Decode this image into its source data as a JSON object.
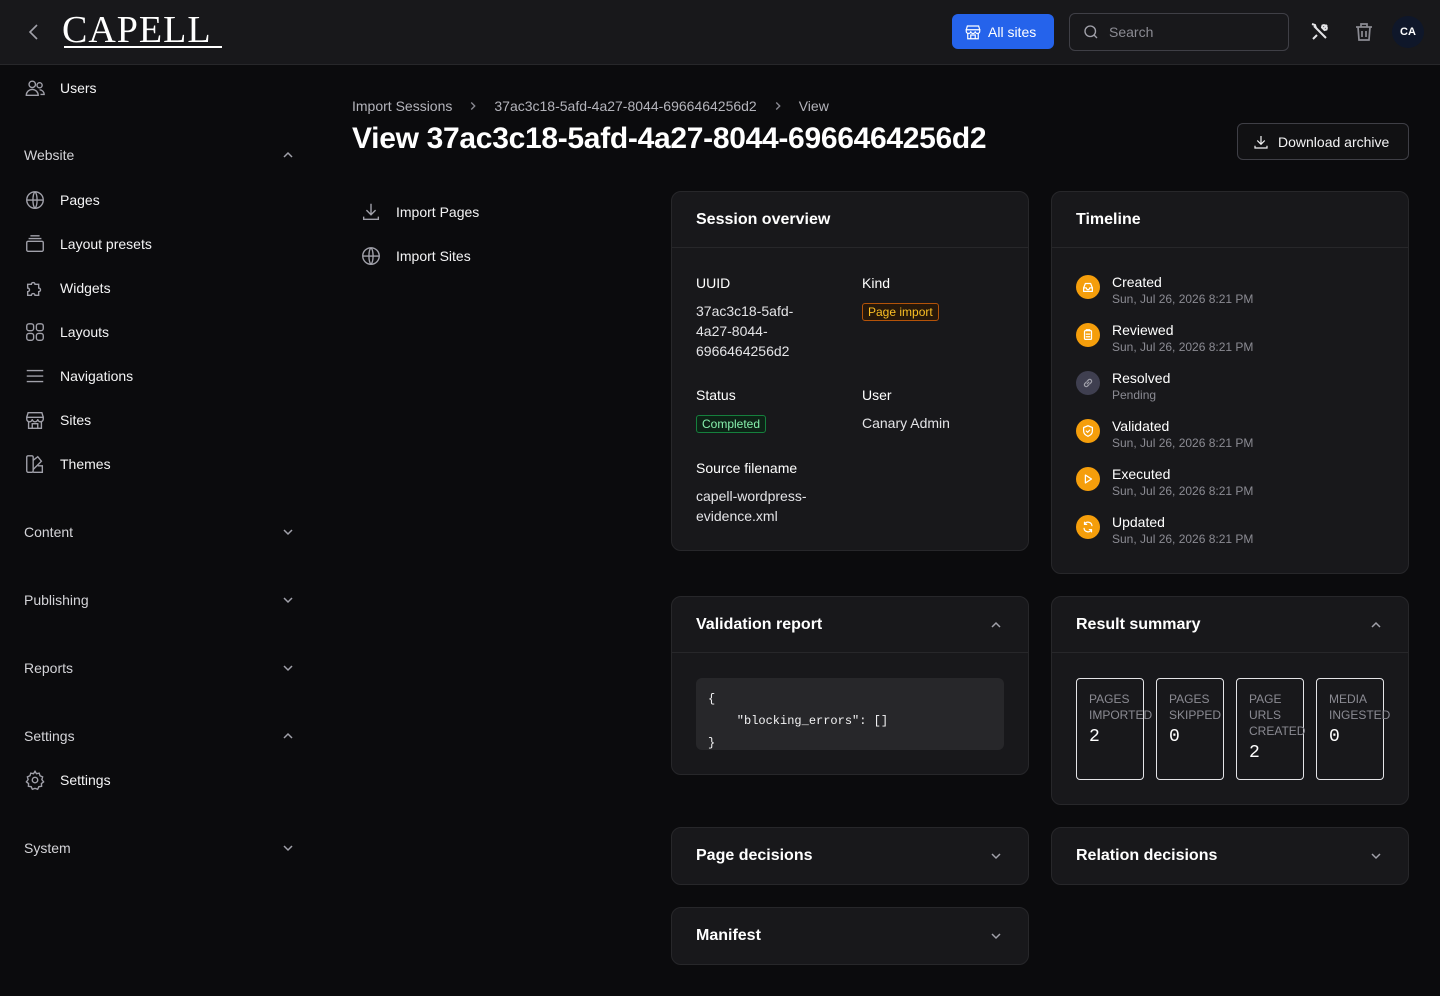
{
  "topbar": {
    "logo": "CAPELL",
    "all_sites_label": "All sites",
    "search_placeholder": "Search",
    "avatar_initials": "CA"
  },
  "sidebar": {
    "users_label": "Users",
    "website": {
      "label": "Website",
      "items": [
        "Pages",
        "Layout presets",
        "Widgets",
        "Layouts",
        "Navigations",
        "Sites",
        "Themes"
      ]
    },
    "content_label": "Content",
    "publishing_label": "Publishing",
    "reports_label": "Reports",
    "settings": {
      "label": "Settings",
      "items": [
        "Settings"
      ]
    },
    "system_label": "System"
  },
  "breadcrumb": [
    "Import Sessions",
    "37ac3c18-5afd-4a27-8044-6966464256d2",
    "View"
  ],
  "page_title": "View 37ac3c18-5afd-4a27-8044-6966464256d2",
  "download_label": "Download archive",
  "subnav": [
    "Import Pages",
    "Import Sites"
  ],
  "session_overview": {
    "title": "Session overview",
    "uuid_label": "UUID",
    "uuid_lines": [
      "37ac3c18-5afd-",
      "4a27-8044-",
      "6966464256d2"
    ],
    "kind_label": "Kind",
    "kind_value": "Page import",
    "status_label": "Status",
    "status_value": "Completed",
    "user_label": "User",
    "user_value": "Canary Admin",
    "source_label": "Source filename",
    "source_lines": [
      "capell-wordpress-",
      "evidence.xml"
    ]
  },
  "timeline": {
    "title": "Timeline",
    "items": [
      {
        "name": "Created",
        "time": "Sun, Jul 26, 2026 8:21 PM",
        "icon": "inbox-icon",
        "color": "#f59e0b"
      },
      {
        "name": "Reviewed",
        "time": "Sun, Jul 26, 2026 8:21 PM",
        "icon": "clipboard-icon",
        "color": "#f59e0b"
      },
      {
        "name": "Resolved",
        "time": "Pending",
        "icon": "link-icon",
        "color": "#3f3f50"
      },
      {
        "name": "Validated",
        "time": "Sun, Jul 26, 2026 8:21 PM",
        "icon": "shield-check-icon",
        "color": "#f59e0b"
      },
      {
        "name": "Executed",
        "time": "Sun, Jul 26, 2026 8:21 PM",
        "icon": "play-icon",
        "color": "#f59e0b"
      },
      {
        "name": "Updated",
        "time": "Sun, Jul 26, 2026 8:21 PM",
        "icon": "refresh-icon",
        "color": "#f59e0b"
      }
    ]
  },
  "validation_report": {
    "title": "Validation report",
    "code": "{\n    \"blocking_errors\": []\n}"
  },
  "result_summary": {
    "title": "Result summary",
    "stats": [
      {
        "label": "PAGES\nIMPORTED",
        "value": "2"
      },
      {
        "label": "PAGES\nSKIPPED",
        "value": "0"
      },
      {
        "label": "PAGE\nURLS\nCREATED",
        "value": "2"
      },
      {
        "label": "MEDIA\nINGESTED",
        "value": "0"
      }
    ]
  },
  "page_decisions_title": "Page decisions",
  "relation_decisions_title": "Relation decisions",
  "manifest_title": "Manifest"
}
